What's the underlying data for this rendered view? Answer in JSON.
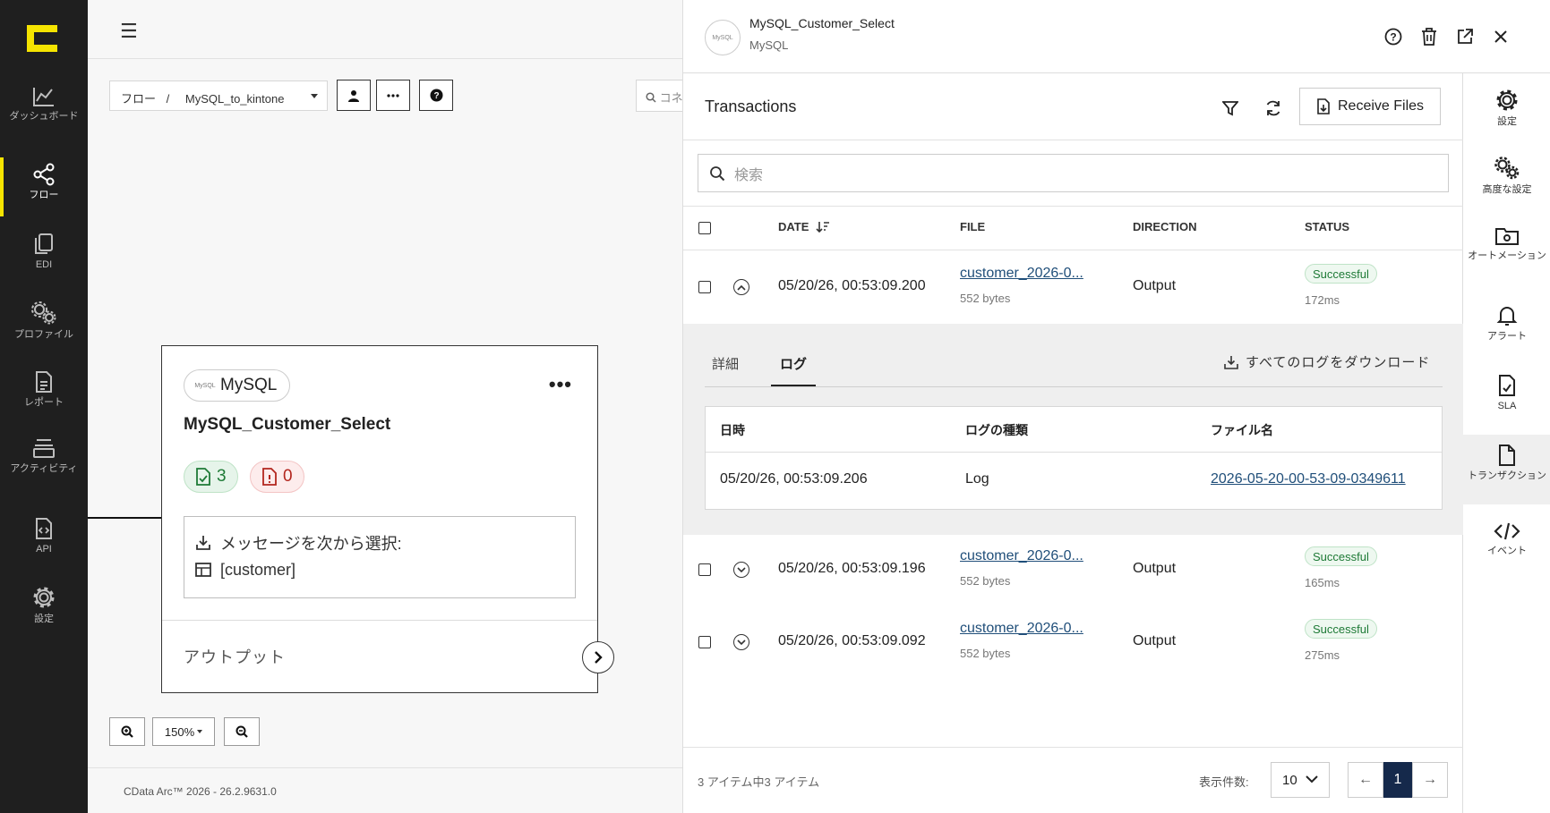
{
  "nav": {
    "items": [
      {
        "label": "ダッシュボード",
        "icon": "chart-line-icon"
      },
      {
        "label": "フロー",
        "icon": "share-nodes-icon"
      },
      {
        "label": "EDI",
        "icon": "documents-icon"
      },
      {
        "label": "プロファイル",
        "icon": "gears-icon"
      },
      {
        "label": "レポート",
        "icon": "report-icon"
      },
      {
        "label": "アクティビティ",
        "icon": "layers-icon"
      },
      {
        "label": "API",
        "icon": "code-file-icon"
      },
      {
        "label": "設定",
        "icon": "gear-icon"
      }
    ],
    "active": "フロー",
    "accent": "#f5e400"
  },
  "canvas": {
    "breadcrumb_root": "フロー",
    "breadcrumb_sep": "/",
    "flow_name": "MySQL_to_kintone",
    "search_placeholder": "コネ",
    "zoom_level": "150%",
    "footer": "CData Arc™ 2026 - 26.2.9631.0"
  },
  "card": {
    "connector_type": "MySQL",
    "logo_text": "MySQL",
    "menu": "•••",
    "title": "MySQL_Customer_Select",
    "success_count": "3",
    "error_count": "0",
    "message_label": "メッセージを次から選択:",
    "table_name": "[customer]",
    "output_label": "アウトプット"
  },
  "panel": {
    "title": "MySQL_Customer_Select",
    "subtitle": "MySQL",
    "logo_text": "MySQL",
    "section_title": "Transactions",
    "receive_button": "Receive Files",
    "search_placeholder": "検索",
    "columns": {
      "date": "DATE",
      "file": "FILE",
      "direction": "DIRECTION",
      "status": "STATUS"
    },
    "rows": [
      {
        "date": "05/20/26, 00:53:09.200",
        "file": "customer_2026-0...",
        "size": "552 bytes",
        "direction": "Output",
        "status": "Successful",
        "duration": "172ms"
      },
      {
        "date": "05/20/26, 00:53:09.196",
        "file": "customer_2026-0...",
        "size": "552 bytes",
        "direction": "Output",
        "status": "Successful",
        "duration": "165ms"
      },
      {
        "date": "05/20/26, 00:53:09.092",
        "file": "customer_2026-0...",
        "size": "552 bytes",
        "direction": "Output",
        "status": "Successful",
        "duration": "275ms"
      }
    ],
    "detail": {
      "tab_details": "詳細",
      "tab_log": "ログ",
      "download_all": "すべてのログをダウンロード",
      "log_columns": {
        "datetime": "日時",
        "type": "ログの種類",
        "filename": "ファイル名"
      },
      "log_row": {
        "datetime": "05/20/26, 00:53:09.206",
        "type": "Log",
        "filename": "2026-05-20-00-53-09-0349611"
      }
    },
    "pager": {
      "summary": "3 アイテム中3 アイテム",
      "per_page_label": "表示件数:",
      "per_page": "10",
      "current_page": "1",
      "prev": "←",
      "next": "→"
    },
    "colors": {
      "success": "#1e7a36",
      "link": "#1f4e79",
      "page_active": "#15294b"
    }
  },
  "right_sidebar": {
    "items": [
      {
        "label": "設定",
        "icon": "gear-icon"
      },
      {
        "label": "高度な設定",
        "icon": "gears-icon"
      },
      {
        "label": "オートメーション",
        "icon": "folder-gear-icon"
      },
      {
        "label": "アラート",
        "icon": "bell-icon"
      },
      {
        "label": "SLA",
        "icon": "file-sla-icon"
      },
      {
        "label": "トランザクション",
        "icon": "file-icon"
      },
      {
        "label": "イベント",
        "icon": "code-icon"
      }
    ],
    "active": "トランザクション"
  }
}
